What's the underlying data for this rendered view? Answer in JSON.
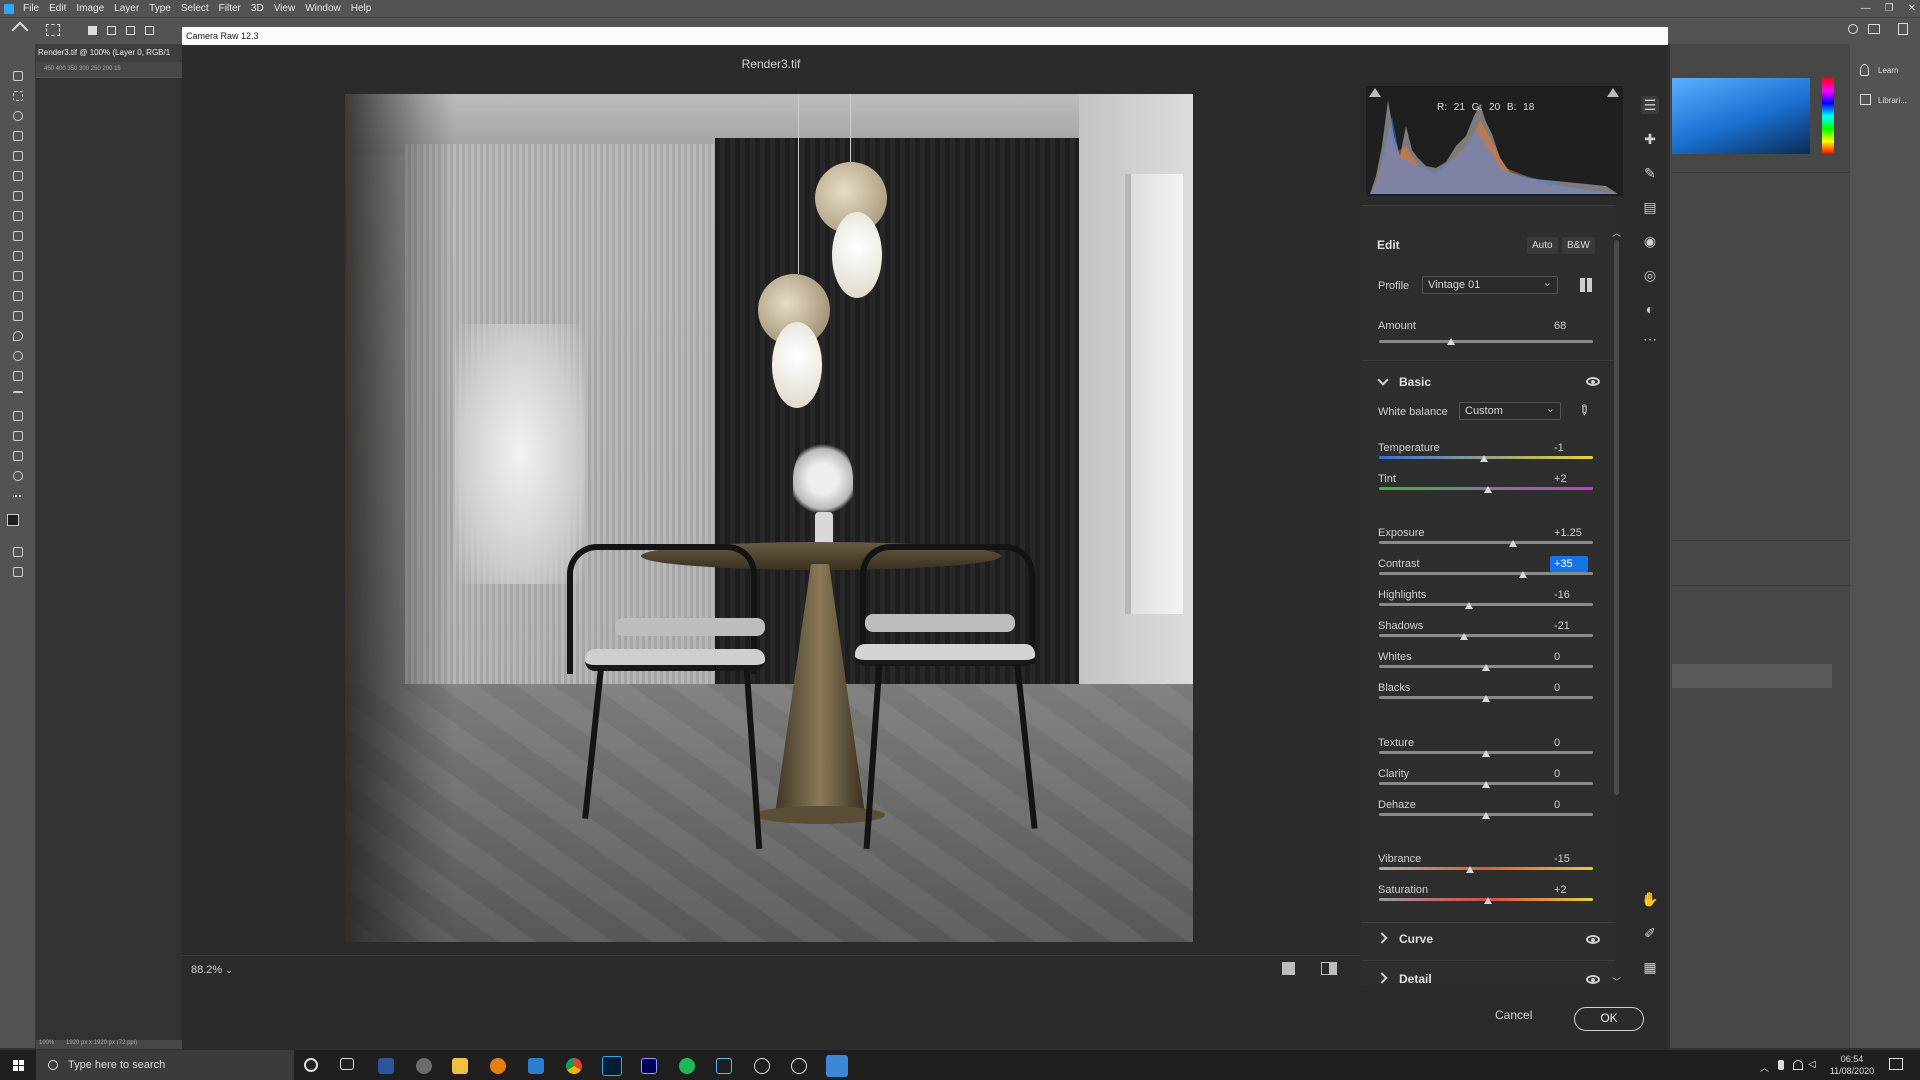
{
  "ps": {
    "menu": [
      "File",
      "Edit",
      "Image",
      "Layer",
      "Type",
      "Select",
      "Filter",
      "3D",
      "View",
      "Window",
      "Help"
    ],
    "doc_tab": "Render3.tif @ 100% (Layer 0, RGB/1",
    "ruler_ticks": "450  400  350  300  250  200  15",
    "status_zoom": "100%",
    "status_doc": "1920 px x 1920 px (72 ppi)",
    "learn": "Learn",
    "libraries": "Librari..."
  },
  "dialog": {
    "title": "Camera Raw 12.3",
    "filename": "Render3.tif",
    "zoom": "88.2%",
    "cancel": "Cancel",
    "ok": "OK"
  },
  "histogram": {
    "readout": "R: 21  G: 20  B: 18"
  },
  "edit": {
    "title": "Edit",
    "auto": "Auto",
    "bw": "B&W",
    "profile_label": "Profile",
    "profile_value": "Vintage 01",
    "amount_label": "Amount",
    "amount_value": "68",
    "basic_title": "Basic",
    "wb_label": "White balance",
    "wb_value": "Custom",
    "sliders": [
      {
        "label": "Temperature",
        "value": "-1",
        "pos": 0.49
      },
      {
        "label": "Tint",
        "value": "+2",
        "pos": 0.51
      },
      {
        "label": "Exposure",
        "value": "+1.25",
        "pos": 0.625
      },
      {
        "label": "Contrast",
        "value": "+35",
        "pos": 0.675
      },
      {
        "label": "Highlights",
        "value": "-16",
        "pos": 0.42
      },
      {
        "label": "Shadows",
        "value": "-21",
        "pos": 0.395
      },
      {
        "label": "Whites",
        "value": "0",
        "pos": 0.5
      },
      {
        "label": "Blacks",
        "value": "0",
        "pos": 0.5
      },
      {
        "label": "Texture",
        "value": "0",
        "pos": 0.5
      },
      {
        "label": "Clarity",
        "value": "0",
        "pos": 0.5
      },
      {
        "label": "Dehaze",
        "value": "0",
        "pos": 0.5
      },
      {
        "label": "Vibrance",
        "value": "-15",
        "pos": 0.425
      },
      {
        "label": "Saturation",
        "value": "+2",
        "pos": 0.51
      }
    ],
    "curve_title": "Curve",
    "detail_title": "Detail"
  },
  "taskbar": {
    "search_placeholder": "Type here to search",
    "time": "06:54",
    "date": "11/08/2020"
  },
  "colors": {
    "accent": "#1473e6",
    "ps_blue": "#31a8ff"
  }
}
